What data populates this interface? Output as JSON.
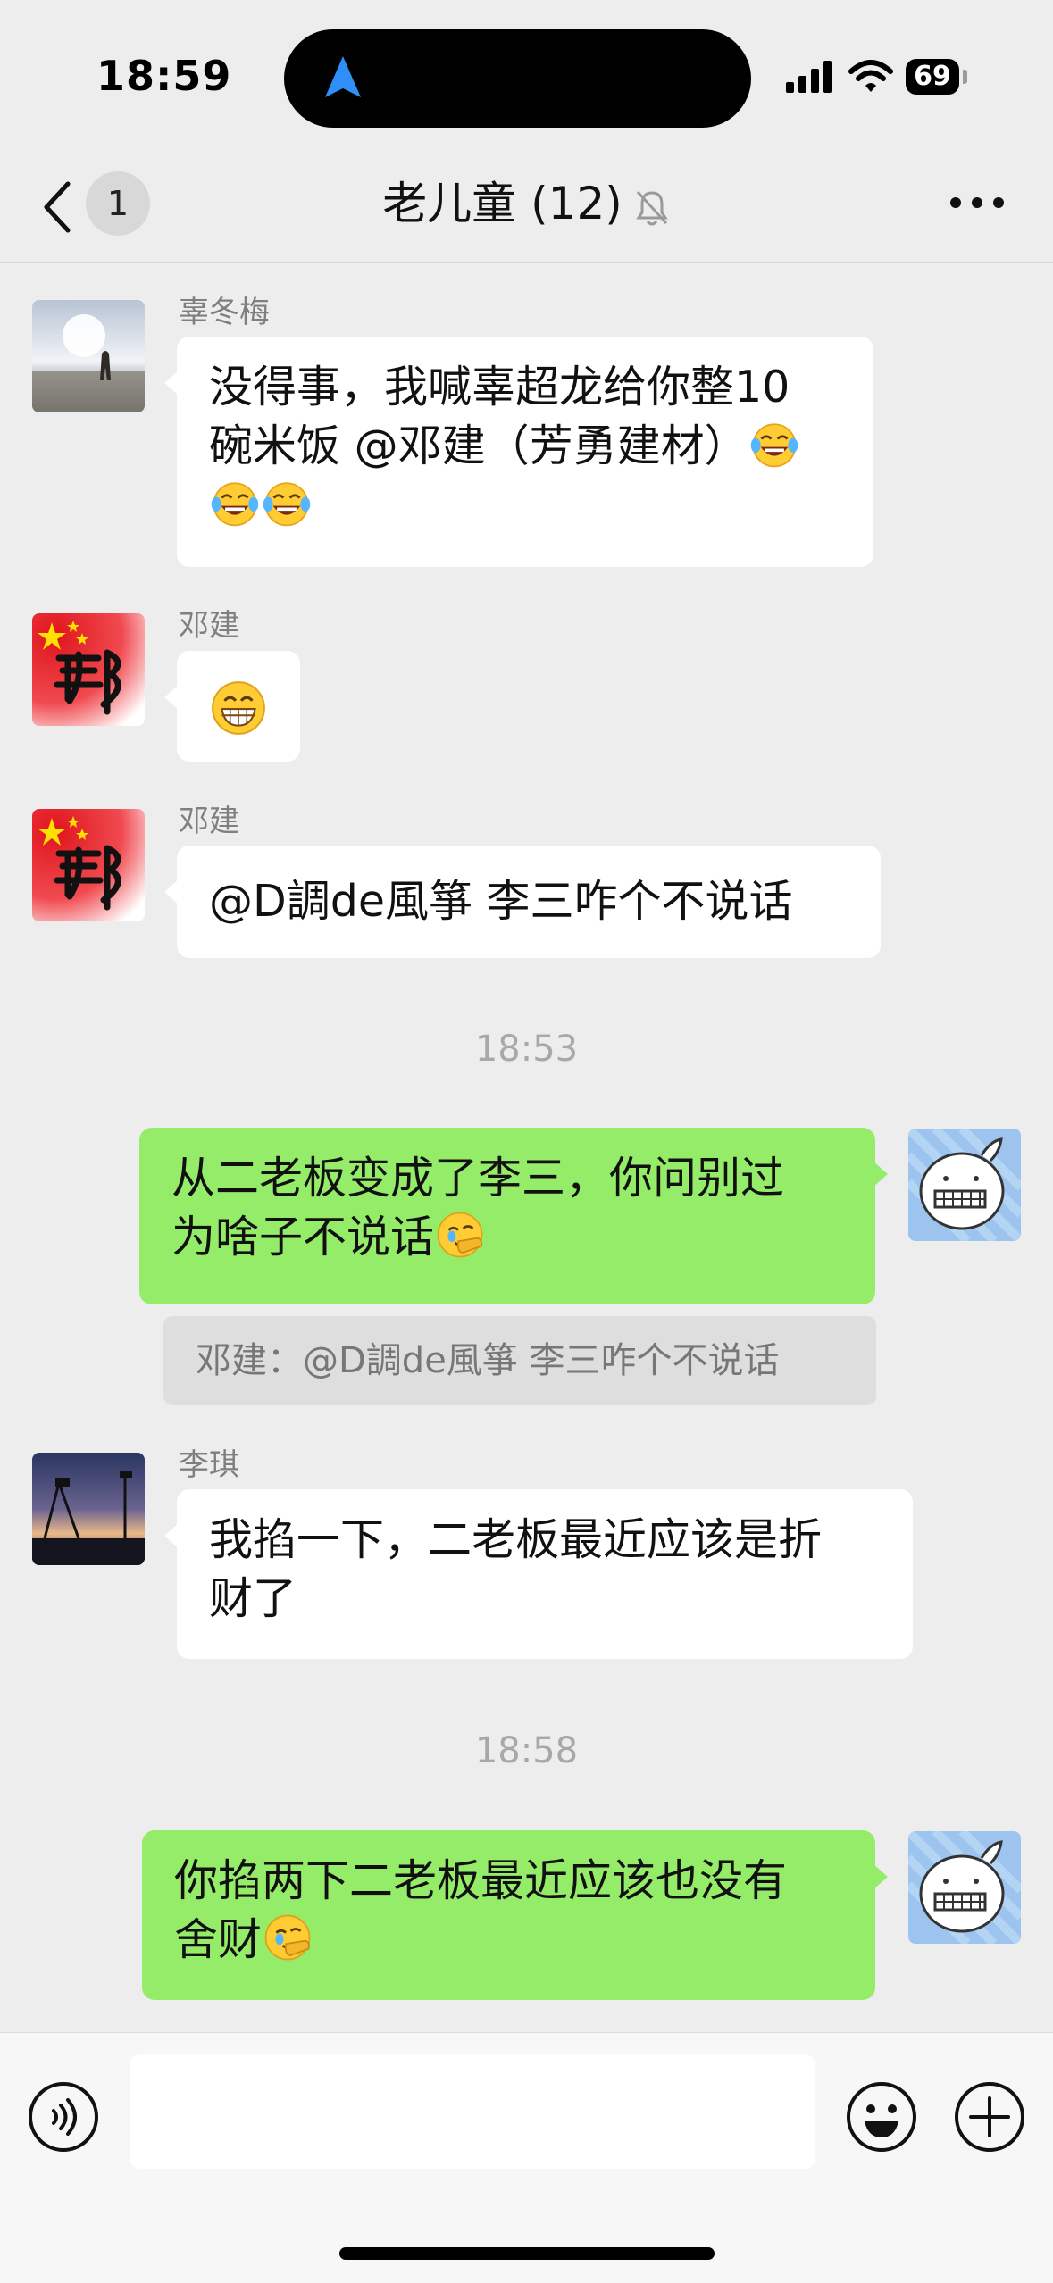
{
  "status_bar": {
    "time": "18:59",
    "battery": "69"
  },
  "nav": {
    "back_badge": "1",
    "title": "老儿童 (12)"
  },
  "messages": [
    {
      "sender": "辜冬梅",
      "line1": "没得事，我喊辜超龙给你整10",
      "line2": "碗米饭 @邓建（芳勇建材）"
    },
    {
      "sender": "邓建"
    },
    {
      "sender": "邓建",
      "text": "@D調de風箏 李三咋个不说话"
    },
    {
      "time": "18:53",
      "line1": "从二老板变成了李三，你问别过",
      "line2": "为啥子不说话",
      "quote": "邓建：@D調de風箏 李三咋个不说话"
    },
    {
      "sender": "李琪",
      "line1": "我掐一下，二老板最近应该是折",
      "line2": "财了"
    },
    {
      "time": "18:58",
      "line1": "你掐两下二老板最近应该也没有",
      "line2": "舍财"
    }
  ],
  "colors": {
    "background": "#ededed",
    "bubble_in": "#ffffff",
    "bubble_out": "#95ec69",
    "nav_accent": "#2f8ef7"
  },
  "icons": {
    "back": "chevron-left-icon",
    "mute": "bell-slash-icon",
    "more": "ellipsis-icon",
    "voice": "voice-icon",
    "emoji": "smiley-icon",
    "plus": "plus-circle-icon"
  }
}
